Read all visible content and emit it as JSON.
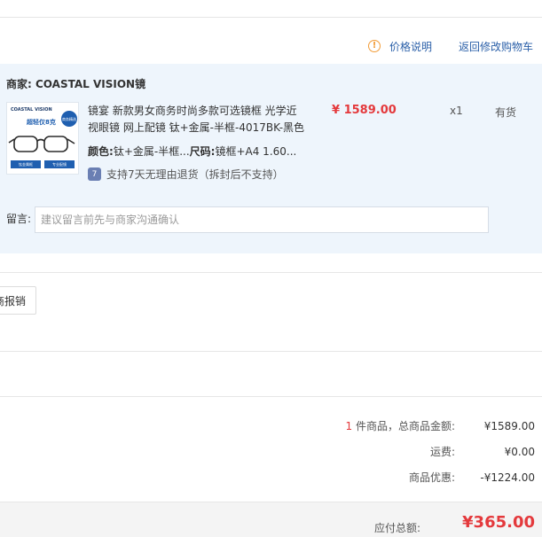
{
  "header": {
    "price_info_label": "价格说明",
    "back_to_cart_label": "返回修改购物车"
  },
  "shop": {
    "label": "商家:",
    "name": "COASTAL VISION镜",
    "product": {
      "title": "镜宴 新款男女商务时尚多款可选镜框 光学近视眼镜 网上配镜 钛+金属-半框-4017BK-黑色",
      "color_label": "颜色:",
      "color_value": "钛+金属-半框...",
      "size_label": "尺码:",
      "size_value": "镜框+A4 1.60...",
      "return_policy": "支持7天无理由退货（拆封后不支持）",
      "price": "¥ 1589.00",
      "quantity": "x1",
      "stock": "有货",
      "thumb": {
        "brand": "COASTAL VISION",
        "tagline": "超轻仅8克",
        "badge": "商务精选",
        "tags": [
          "钛金属框",
          "专业配镜"
        ]
      }
    },
    "memo": {
      "label": "留言:",
      "placeholder": "建议留言前先与商家沟通确认"
    }
  },
  "invoice": {
    "button_label": "商报销"
  },
  "summary": {
    "item_count": "1",
    "items_label": "件商品，总商品金额:",
    "items_total": "¥1589.00",
    "shipping_label": "运费:",
    "shipping_value": "¥0.00",
    "discount_label": "商品优惠:",
    "discount_value": "-¥1224.00",
    "total_label": "应付总额:",
    "total_value": "¥365.00"
  },
  "colors": {
    "accent_red": "#e4393c",
    "link_blue": "#2a5fa8",
    "panel_bg": "#eef5fc",
    "info_orange": "#f29c38"
  },
  "icons": {
    "price_info": "info-icon",
    "return_policy": "return-policy-icon"
  }
}
